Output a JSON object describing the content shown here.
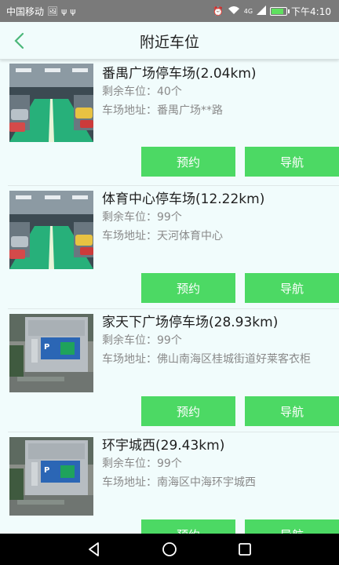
{
  "status_bar": {
    "carrier": "中国移动",
    "signal": "4G",
    "time": "下午4:10",
    "battery_level": 0.9
  },
  "header": {
    "title": "附近车位"
  },
  "colors": {
    "accent": "#4cd964",
    "background": "#f1fcfc",
    "status_bar": "#7a7a7a"
  },
  "parking_list": [
    {
      "name": "番禺广场停车场(2.04km)",
      "spaces": "剩余车位：40个",
      "address": "车场地址：番禺广场**路",
      "reserve_label": "预约",
      "navigate_label": "导航",
      "photo": "garage"
    },
    {
      "name": "体育中心停车场(12.22km)",
      "spaces": "剩余车位：99个",
      "address": "车场地址：天河体育中心",
      "reserve_label": "预约",
      "navigate_label": "导航",
      "photo": "garage"
    },
    {
      "name": "家天下广场停车场(28.93km)",
      "spaces": "剩余车位：99个",
      "address": "车场地址：佛山南海区桂城街道好莱客衣柜",
      "reserve_label": "预约",
      "navigate_label": "导航",
      "photo": "kiosk"
    },
    {
      "name": "环宇城西(29.43km)",
      "spaces": "剩余车位：99个",
      "address": "车场地址：南海区中海环宇城西",
      "reserve_label": "预约",
      "navigate_label": "导航",
      "photo": "kiosk"
    }
  ],
  "nav_bar": {
    "back_icon": "triangle-back",
    "home_icon": "circle-home",
    "recents_icon": "square-recents"
  }
}
